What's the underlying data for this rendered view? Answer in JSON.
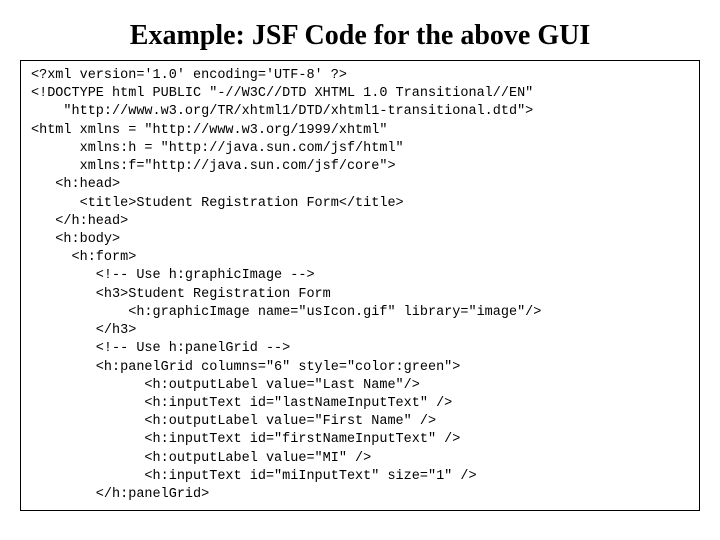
{
  "title": "Example: JSF Code for the above GUI",
  "code": {
    "l01": "<?xml version='1.0' encoding='UTF-8' ?>",
    "l02": "<!DOCTYPE html PUBLIC \"-//W3C//DTD XHTML 1.0 Transitional//EN\"",
    "l03": "    \"http://www.w3.org/TR/xhtml1/DTD/xhtml1-transitional.dtd\">",
    "l04": "<html xmlns = \"http://www.w3.org/1999/xhtml\"",
    "l05": "      xmlns:h = \"http://java.sun.com/jsf/html\"",
    "l06": "      xmlns:f=\"http://java.sun.com/jsf/core\">",
    "l07": "   <h:head>",
    "l08": "      <title>Student Registration Form</title>",
    "l09": "   </h:head>",
    "l10": "   <h:body>",
    "l11": "     <h:form>",
    "l12": "        <!-- Use h:graphicImage -->",
    "l13": "        <h3>Student Registration Form",
    "l14": "            <h:graphicImage name=\"usIcon.gif\" library=\"image\"/>",
    "l15": "        </h3>",
    "l16": "        <!-- Use h:panelGrid -->",
    "l17": "        <h:panelGrid columns=\"6\" style=\"color:green\">",
    "l18": "              <h:outputLabel value=\"Last Name\"/>",
    "l19": "              <h:inputText id=\"lastNameInputText\" />",
    "l20": "              <h:outputLabel value=\"First Name\" />",
    "l21": "              <h:inputText id=\"firstNameInputText\" />",
    "l22": "              <h:outputLabel value=\"MI\" />",
    "l23": "              <h:inputText id=\"miInputText\" size=\"1\" />",
    "l24": "        </h:panelGrid>"
  }
}
